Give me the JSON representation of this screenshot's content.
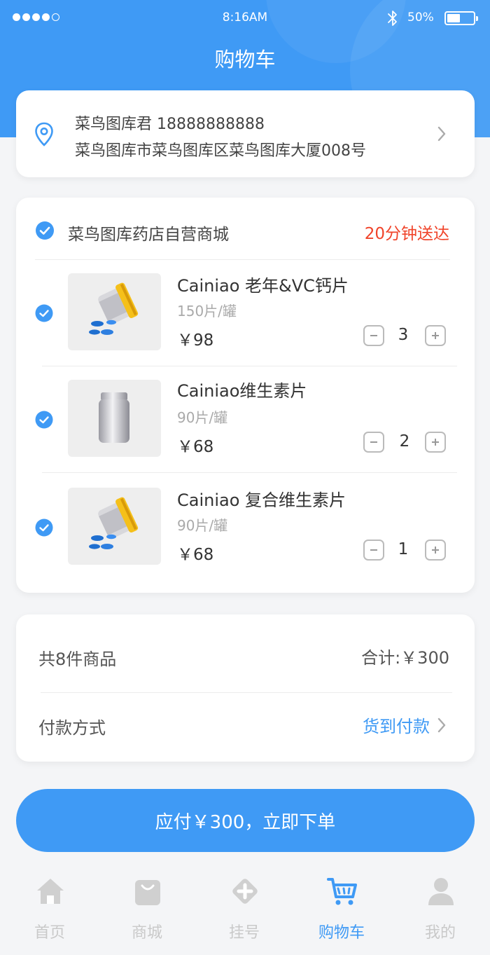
{
  "status_bar": {
    "time": "8:16AM",
    "battery": "50%"
  },
  "header": {
    "title": "购物车"
  },
  "address": {
    "line1": "菜鸟图库君 18888888888",
    "line2": "菜鸟图库市菜鸟图库区菜鸟图库大厦008号"
  },
  "store": {
    "name": "菜鸟图库药店自营商城",
    "delivery": "20分钟送达"
  },
  "items": [
    {
      "name": "Cainiao 老年&VC钙片",
      "spec": "150片/罐",
      "price": "￥98",
      "qty": "3"
    },
    {
      "name": "Cainiao维生素片",
      "spec": "90片/罐",
      "price": "￥68",
      "qty": "2"
    },
    {
      "name": "Cainiao  复合维生素片",
      "spec": "90片/罐",
      "price": "￥68",
      "qty": "1"
    }
  ],
  "summary": {
    "count": "共8件商品",
    "total": "合计:￥300",
    "payment_label": "付款方式",
    "payment_method": "货到付款"
  },
  "submit_label": "应付￥300，立即下单",
  "tabs": [
    {
      "label": "首页",
      "icon": "home-icon"
    },
    {
      "label": "商城",
      "icon": "shopping-bag-icon"
    },
    {
      "label": "挂号",
      "icon": "medical-cross-icon"
    },
    {
      "label": "购物车",
      "icon": "shopping-cart-icon",
      "active": true
    },
    {
      "label": "我的",
      "icon": "user-icon"
    }
  ],
  "colors": {
    "primary": "#3f9af5",
    "delivery": "#f0442a",
    "background": "#f4f5f7"
  }
}
